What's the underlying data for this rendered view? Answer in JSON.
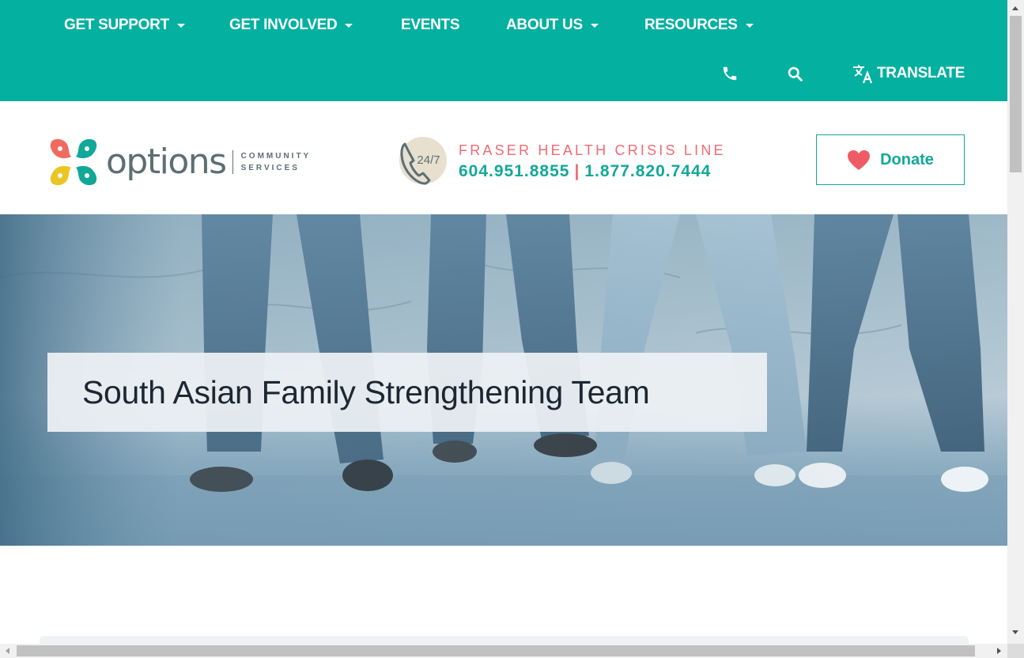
{
  "nav": {
    "items": [
      {
        "label": "GET SUPPORT",
        "dropdown": true
      },
      {
        "label": "GET INVOLVED",
        "dropdown": true
      },
      {
        "label": "EVENTS",
        "dropdown": false
      },
      {
        "label": "ABOUT US",
        "dropdown": true
      },
      {
        "label": "RESOURCES",
        "dropdown": true
      }
    ],
    "utility": {
      "phone_icon": "phone-icon",
      "search_icon": "search-icon",
      "translate_icon": "translate-icon",
      "translate_label": "TRANSLATE"
    }
  },
  "header": {
    "logo": {
      "wordmark": "options",
      "sub_line1": "COMMUNITY",
      "sub_line2": "SERVICES"
    },
    "crisis": {
      "badge": "24/7",
      "title": "FRASER HEALTH CRISIS LINE",
      "phone1": "604.951.8855",
      "separator": "|",
      "phone2": "1.877.820.7444"
    },
    "donate": {
      "label": "Donate",
      "icon": "heart-icon"
    }
  },
  "hero": {
    "title": "South Asian Family Strengthening Team"
  },
  "colors": {
    "brand_teal": "#04b0a0",
    "accent_teal": "#12a898",
    "accent_coral": "#ef6b73",
    "text_dark": "#1c2733"
  }
}
